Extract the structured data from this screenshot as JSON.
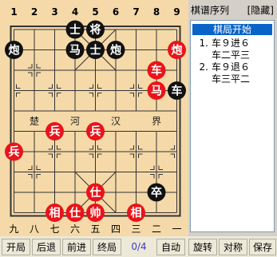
{
  "board": {
    "top_numbers": [
      "1",
      "2",
      "3",
      "4",
      "5",
      "6",
      "7",
      "8",
      "9"
    ],
    "bottom_numbers": [
      "九",
      "八",
      "七",
      "六",
      "五",
      "四",
      "三",
      "二",
      "一"
    ],
    "river_left": [
      "楚",
      "河"
    ],
    "river_right": [
      "汉",
      "界"
    ],
    "colors": {
      "red": "#e8141a",
      "black": "#111111",
      "board": "#f5d9a8",
      "line": "#333333"
    },
    "pieces": [
      {
        "label": "士",
        "side": "black",
        "file": 4,
        "rank": 0
      },
      {
        "label": "将",
        "side": "black",
        "file": 5,
        "rank": 0
      },
      {
        "label": "炮",
        "side": "black",
        "file": 1,
        "rank": 1
      },
      {
        "label": "马",
        "side": "black",
        "file": 4,
        "rank": 1
      },
      {
        "label": "士",
        "side": "black",
        "file": 5,
        "rank": 1
      },
      {
        "label": "炮",
        "side": "black",
        "file": 6,
        "rank": 1
      },
      {
        "label": "炮",
        "side": "red",
        "file": 9,
        "rank": 1
      },
      {
        "label": "车",
        "side": "red",
        "file": 8,
        "rank": 2
      },
      {
        "label": "马",
        "side": "red",
        "file": 8,
        "rank": 3
      },
      {
        "label": "车",
        "side": "black",
        "file": 9,
        "rank": 3
      },
      {
        "label": "兵",
        "side": "red",
        "file": 3,
        "rank": 5
      },
      {
        "label": "兵",
        "side": "red",
        "file": 5,
        "rank": 5
      },
      {
        "label": "兵",
        "side": "red",
        "file": 1,
        "rank": 6
      },
      {
        "label": "仕",
        "side": "red",
        "file": 5,
        "rank": 8
      },
      {
        "label": "卒",
        "side": "black",
        "file": 8,
        "rank": 8
      },
      {
        "label": "相",
        "side": "red",
        "file": 3,
        "rank": 9
      },
      {
        "label": "仕",
        "side": "red",
        "file": 4,
        "rank": 9
      },
      {
        "label": "帅",
        "side": "red",
        "file": 5,
        "rank": 9
      },
      {
        "label": "相",
        "side": "red",
        "file": 7,
        "rank": 9
      }
    ]
  },
  "sidebar": {
    "title": "棋谱序列",
    "hide_label": "[隐藏]",
    "start_label": "棋局开始",
    "moves": [
      {
        "num": "1.",
        "red": "车９进６",
        "black": "车二平三"
      },
      {
        "num": "2.",
        "red": "车９退６",
        "black": "车三平二"
      }
    ]
  },
  "toolbar": {
    "open": "开局",
    "back": "后退",
    "forward": "前进",
    "end": "终局",
    "counter": "0/4",
    "auto": "自动",
    "rotate": "旋转",
    "mirror": "对称",
    "save": "保存"
  }
}
